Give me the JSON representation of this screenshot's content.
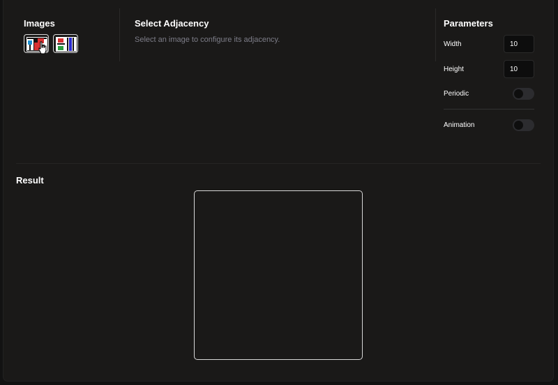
{
  "images": {
    "title": "Images",
    "items": [
      {
        "name": "tile-image-1",
        "selected": true
      },
      {
        "name": "tile-image-2",
        "selected": false
      }
    ]
  },
  "adjacency": {
    "title": "Select Adjacency",
    "hint": "Select an image to configure its adjacency."
  },
  "parameters": {
    "title": "Parameters",
    "width_label": "Width",
    "width_value": "10",
    "height_label": "Height",
    "height_value": "10",
    "periodic_label": "Periodic",
    "periodic_on": false,
    "animation_label": "Animation",
    "animation_on": false
  },
  "result": {
    "title": "Result"
  },
  "colors": {
    "background": "#1a1918",
    "text": "#ffffff",
    "muted": "#7d7d88",
    "border": "#d9d9d9"
  }
}
